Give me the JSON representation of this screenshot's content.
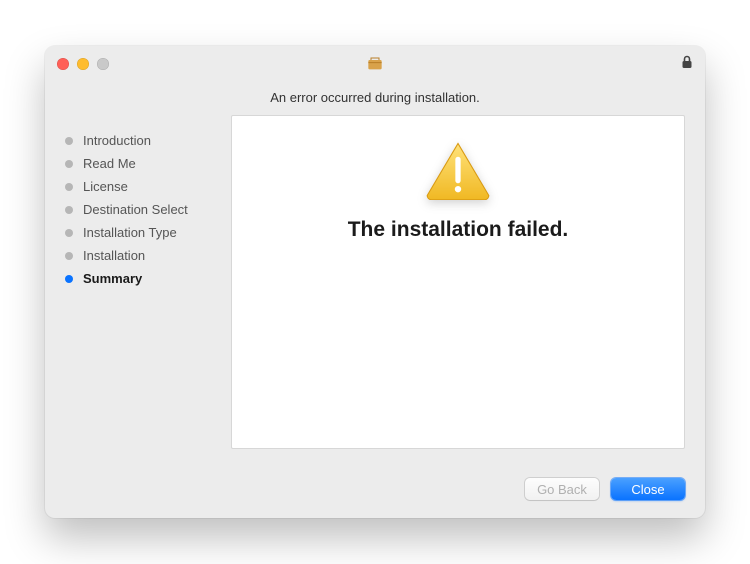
{
  "window": {
    "title": ""
  },
  "subheader": "An error occurred during installation.",
  "sidebar": {
    "steps": [
      {
        "label": "Introduction",
        "active": false
      },
      {
        "label": "Read Me",
        "active": false
      },
      {
        "label": "License",
        "active": false
      },
      {
        "label": "Destination Select",
        "active": false
      },
      {
        "label": "Installation Type",
        "active": false
      },
      {
        "label": "Installation",
        "active": false
      },
      {
        "label": "Summary",
        "active": true
      }
    ]
  },
  "content": {
    "headline": "The installation failed."
  },
  "footer": {
    "go_back_label": "Go Back",
    "close_label": "Close"
  }
}
